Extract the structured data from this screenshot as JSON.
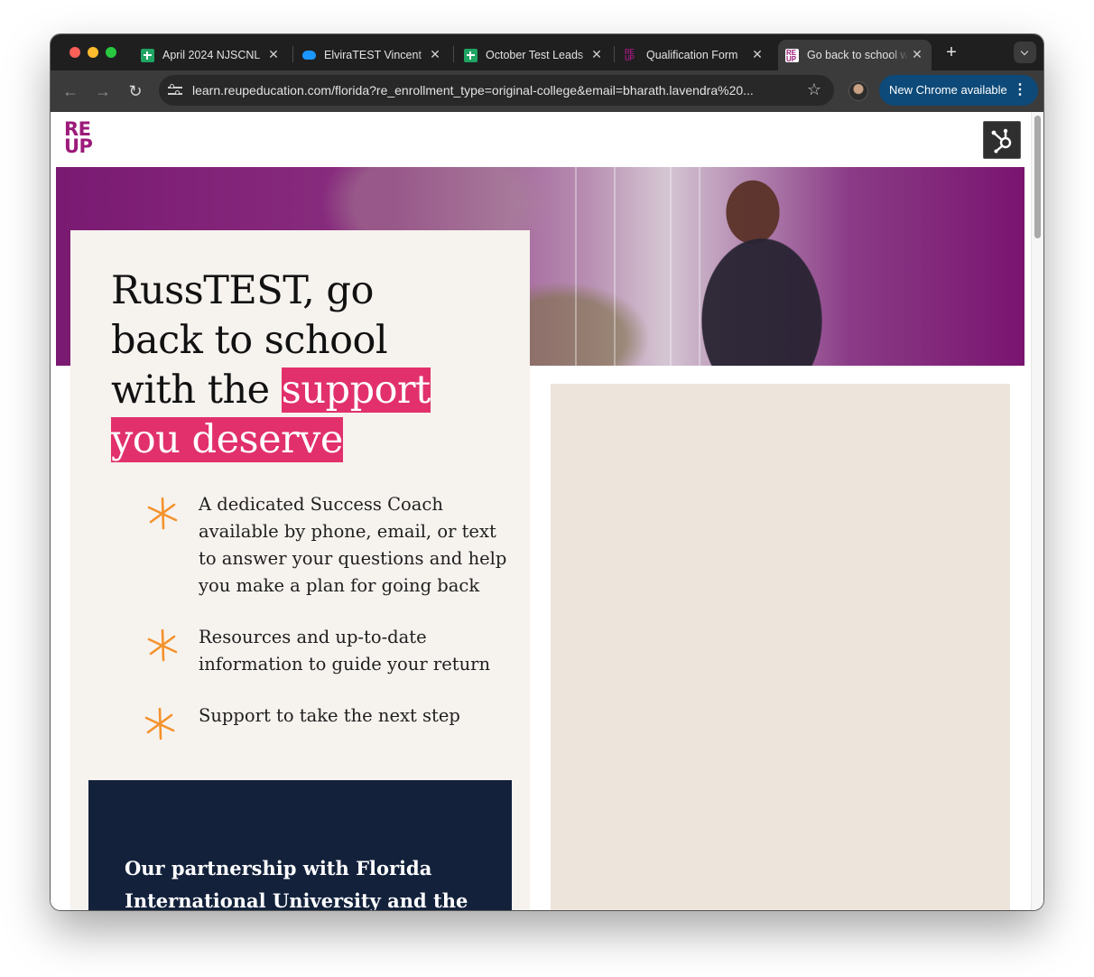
{
  "browser": {
    "tabs": [
      {
        "title": "April 2024 NJSCNL",
        "favicon": "sheets-icon",
        "active": false
      },
      {
        "title": "ElviraTEST Vincent",
        "favicon": "salesforce-cloud-icon",
        "active": false
      },
      {
        "title": "October Test Leads",
        "favicon": "sheets-icon",
        "active": false
      },
      {
        "title": "Qualification Form",
        "favicon": "reup-icon",
        "active": false
      },
      {
        "title": "Go back to school with",
        "favicon": "reup-icon",
        "active": true
      }
    ],
    "url": "learn.reupeducation.com/florida?re_enrollment_type=original-college&email=bharath.lavendra%20...",
    "update_button": "New Chrome available"
  },
  "page": {
    "logo": {
      "line1": "RE",
      "line2": "UP"
    },
    "headline": {
      "plain": "RussTEST, go back to school with the ",
      "highlight_line1": "support",
      "highlight_line2": "you deserve"
    },
    "features": [
      "A dedicated Success Coach available by phone, email, or text to answer your questions and help you make a plan for going back",
      "Resources and up-to-date information to guide your return",
      "Support to take the next step"
    ],
    "partnership_text": "Our partnership with Florida International University and the",
    "colors": {
      "brand_purple": "#9c1a7a",
      "highlight_pink": "#e1306c",
      "asterisk_orange": "#f4922c",
      "navy": "#13213b",
      "card_bg": "#f6f2ee",
      "form_bg": "#ede4dc"
    }
  }
}
